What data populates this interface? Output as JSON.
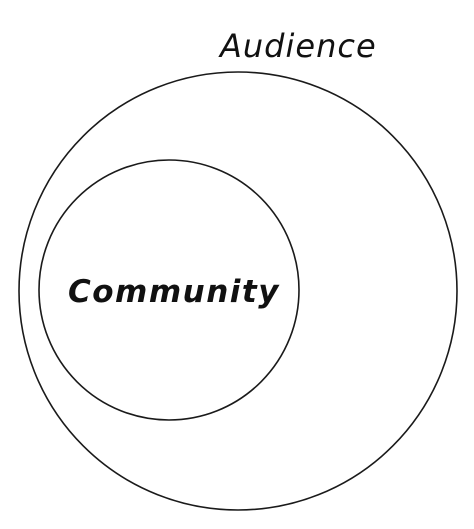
{
  "diagram": {
    "outer_label": "Audience",
    "inner_label": "Community"
  },
  "colors": {
    "stroke": "#1a1a1a",
    "text": "#111111",
    "background": "#ffffff"
  }
}
